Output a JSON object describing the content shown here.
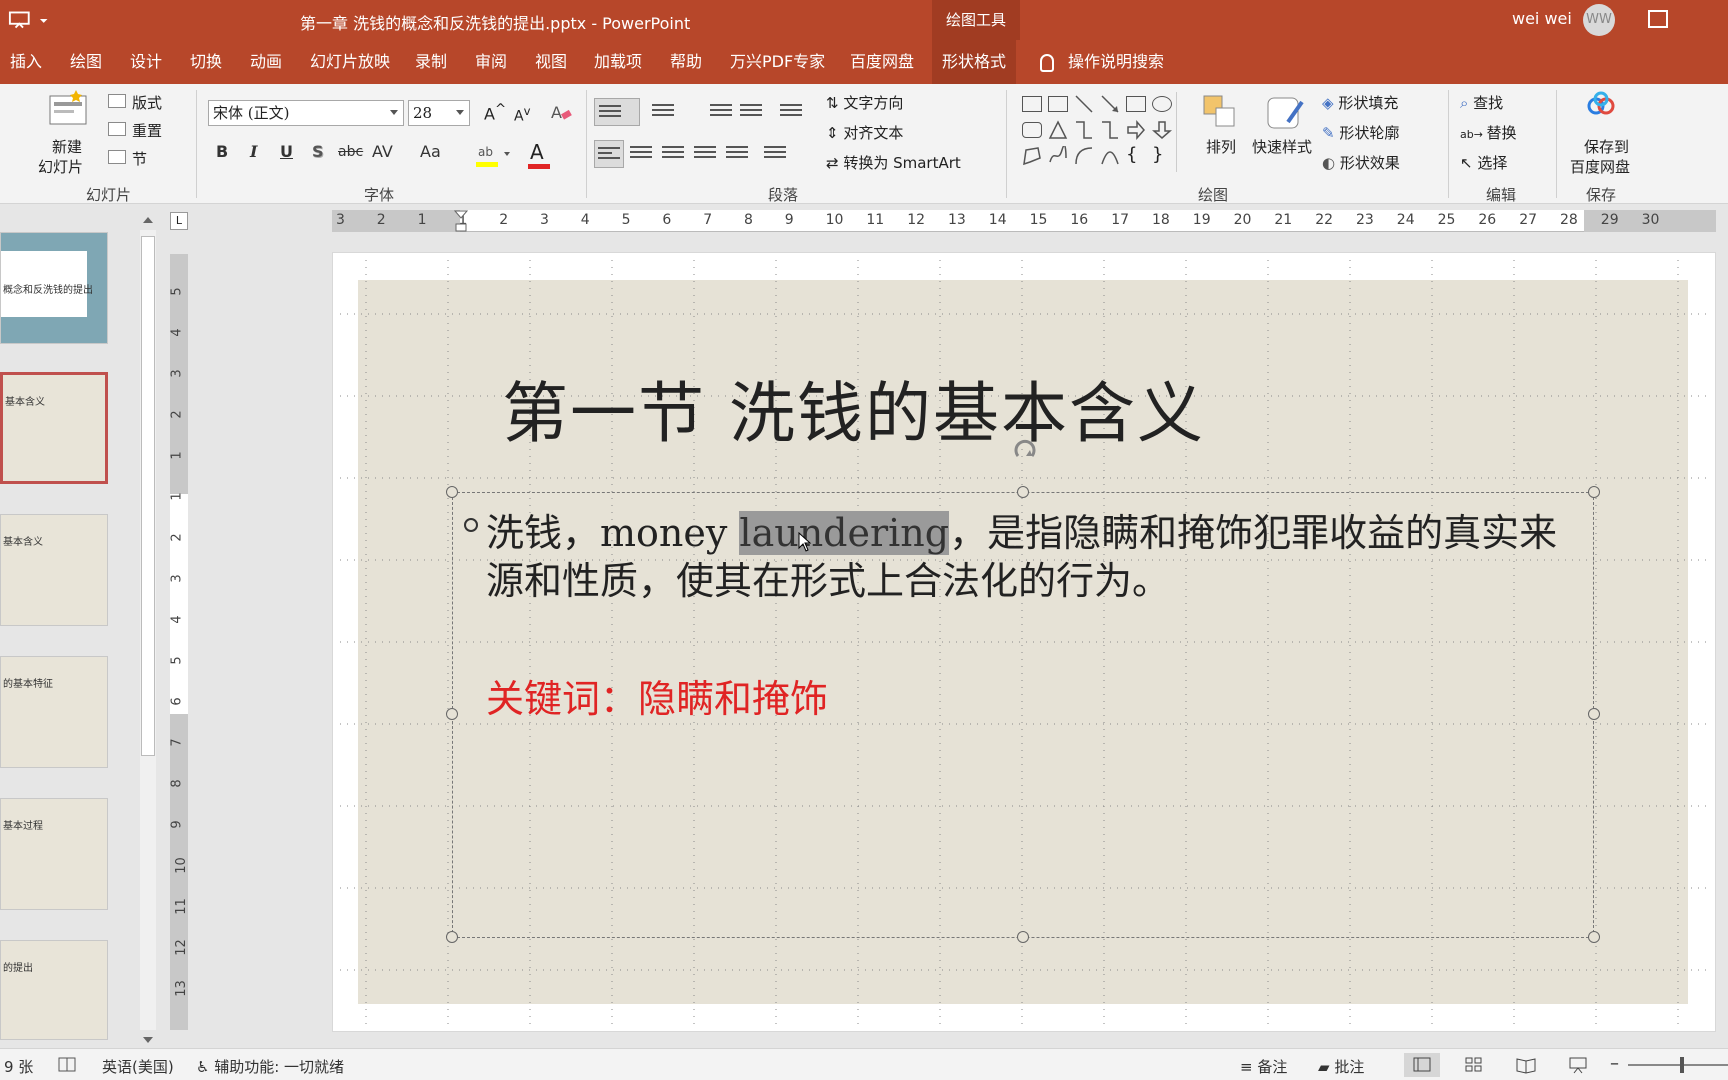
{
  "titlebar": {
    "document_title": "第一章 洗钱的概念和反洗钱的提出.pptx  -  PowerPoint",
    "contextual_group": "绘图工具",
    "user_name": "wei wei",
    "user_initials": "WW"
  },
  "tabs": [
    {
      "label": "插入"
    },
    {
      "label": "绘图"
    },
    {
      "label": "设计"
    },
    {
      "label": "切换"
    },
    {
      "label": "动画"
    },
    {
      "label": "幻灯片放映"
    },
    {
      "label": "录制"
    },
    {
      "label": "审阅"
    },
    {
      "label": "视图"
    },
    {
      "label": "加载项"
    },
    {
      "label": "帮助"
    },
    {
      "label": "万兴PDF专家"
    },
    {
      "label": "百度网盘"
    },
    {
      "label": "形状格式"
    }
  ],
  "tell_me": "操作说明搜索",
  "ribbon": {
    "slides": {
      "new_slide_line1": "新建",
      "new_slide_line2": "幻灯片",
      "layout": "版式",
      "reset": "重置",
      "section": "节",
      "label": "幻灯片"
    },
    "font": {
      "font_name": "宋体 (正文)",
      "font_size": "28",
      "bold": "B",
      "italic": "I",
      "underline": "U",
      "shadow": "S",
      "strike": "abc",
      "spacing": "AV",
      "case": "Aa",
      "color_letter": "A",
      "label": "字体"
    },
    "paragraph": {
      "text_direction": "文字方向",
      "align_text": "对齐文本",
      "convert_smartart": "转换为 SmartArt",
      "label": "段落"
    },
    "drawing": {
      "arrange": "排列",
      "quick_styles": "快速样式",
      "shape_fill": "形状填充",
      "shape_outline": "形状轮廓",
      "shape_effects": "形状效果",
      "label": "绘图"
    },
    "editing": {
      "find": "查找",
      "replace": "替换",
      "select": "选择",
      "label": "编辑"
    },
    "save": {
      "line1": "保存到",
      "line2": "百度网盘",
      "label": "保存"
    }
  },
  "thumbnails": [
    {
      "text": "概念和反洗钱的提出"
    },
    {
      "text": "基本含义"
    },
    {
      "text": "基本含义"
    },
    {
      "text": "的基本特征"
    },
    {
      "text": "基本过程"
    },
    {
      "text": "的提出"
    }
  ],
  "ruler": {
    "h_ticks": [
      "3",
      "2",
      "1",
      "1",
      "2",
      "3",
      "4",
      "5",
      "6",
      "7",
      "8",
      "9",
      "10",
      "11",
      "12",
      "13",
      "14",
      "15",
      "16",
      "17",
      "18",
      "19",
      "20",
      "21",
      "22",
      "23",
      "24",
      "25",
      "26",
      "27",
      "28",
      "29",
      "30"
    ],
    "v_ticks": [
      "5",
      "4",
      "3",
      "2",
      "1",
      "1",
      "2",
      "3",
      "4",
      "5",
      "6",
      "7",
      "8",
      "9",
      "10",
      "11",
      "12",
      "13"
    ],
    "corner": "L"
  },
  "slide": {
    "title": "第一节  洗钱的基本含义",
    "body_line1_before": "洗钱，money ",
    "body_line1_selected": "laundering",
    "body_line1_after": "，是指隐瞒和掩饰犯罪收益的真实来",
    "body_line2": "源和性质，使其在形式上合法化的行为。",
    "keyword": "关键词：隐瞒和掩饰"
  },
  "statusbar": {
    "slide_count": "9 张",
    "language": "英语(美国)",
    "accessibility": "辅助功能: 一切就绪",
    "notes": "备注",
    "comments": "批注"
  },
  "colors": {
    "accent": "#b7472a",
    "slide_background": "#e6e2d6",
    "keyword": "#e02424"
  }
}
